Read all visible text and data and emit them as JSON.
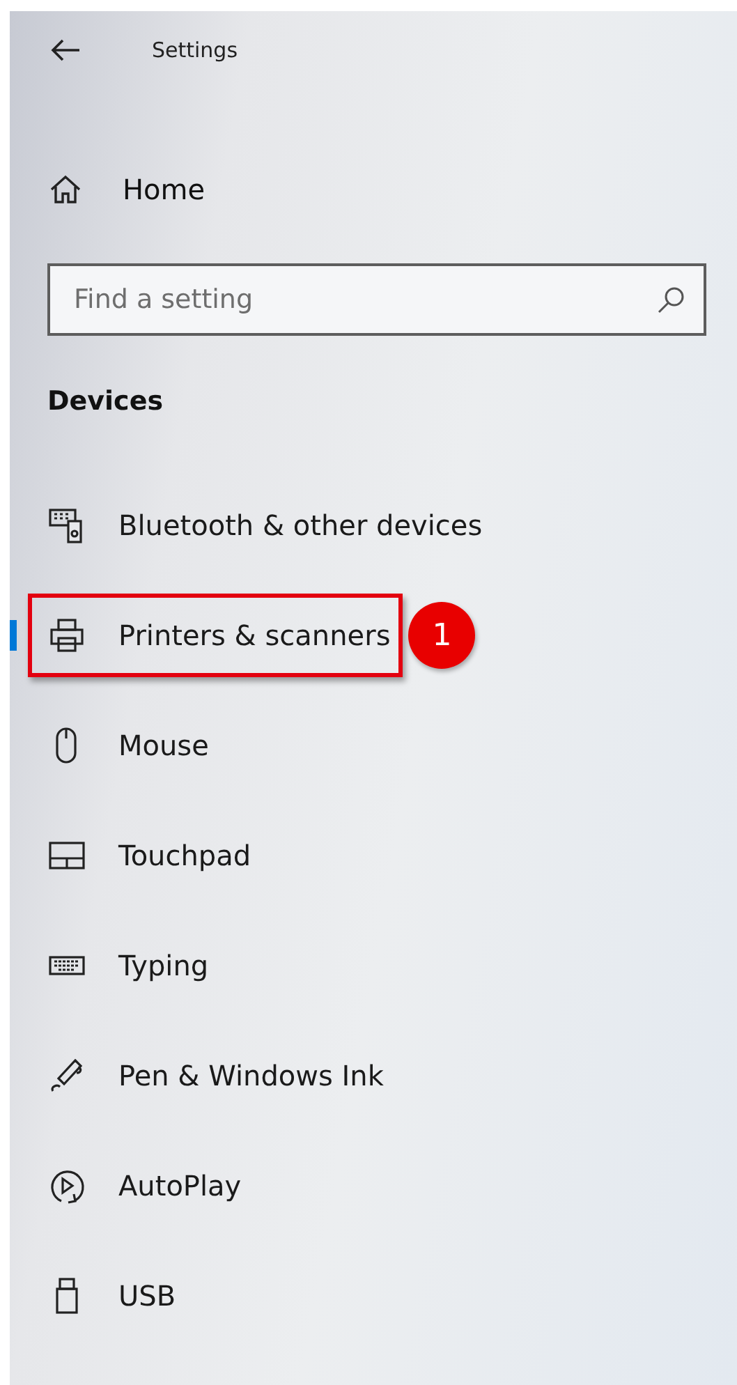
{
  "window": {
    "title": "Settings"
  },
  "home": {
    "label": "Home"
  },
  "search": {
    "placeholder": "Find a setting"
  },
  "section": {
    "title": "Devices"
  },
  "items": [
    {
      "kind": "bluetooth",
      "label": "Bluetooth & other devices",
      "selected": false,
      "highlighted": false
    },
    {
      "kind": "printer",
      "label": "Printers & scanners",
      "selected": true,
      "highlighted": true,
      "callout": "1"
    },
    {
      "kind": "mouse",
      "label": "Mouse",
      "selected": false,
      "highlighted": false
    },
    {
      "kind": "touchpad",
      "label": "Touchpad",
      "selected": false,
      "highlighted": false
    },
    {
      "kind": "typing",
      "label": "Typing",
      "selected": false,
      "highlighted": false
    },
    {
      "kind": "pen",
      "label": "Pen & Windows Ink",
      "selected": false,
      "highlighted": false
    },
    {
      "kind": "autoplay",
      "label": "AutoPlay",
      "selected": false,
      "highlighted": false
    },
    {
      "kind": "usb",
      "label": "USB",
      "selected": false,
      "highlighted": false
    }
  ]
}
